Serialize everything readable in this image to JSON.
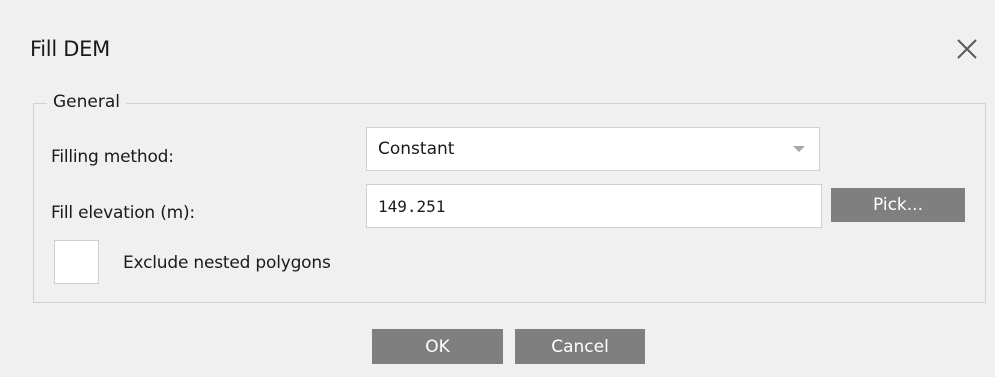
{
  "dialog": {
    "title": "Fill DEM",
    "close_icon": "close-icon"
  },
  "general": {
    "legend": "General",
    "filling_method": {
      "label": "Filling method:",
      "value": "Constant",
      "arrow_icon": "chevron-down-icon"
    },
    "fill_elevation": {
      "label": "Fill elevation (m):",
      "value": "149.251",
      "pick_label": "Pick..."
    },
    "exclude_nested": {
      "label": "Exclude nested polygons",
      "checked": false
    }
  },
  "footer": {
    "ok_label": "OK",
    "cancel_label": "Cancel"
  },
  "colors": {
    "background": "#f0f0f0",
    "button_bg": "#7f7f7f",
    "button_text": "#ffffff",
    "border": "#d2d2d2"
  }
}
